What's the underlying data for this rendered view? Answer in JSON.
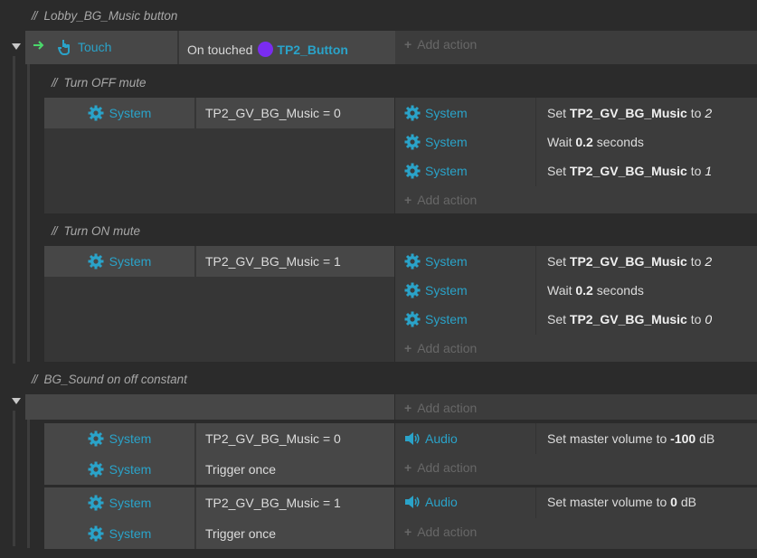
{
  "colors": {
    "accent": "#2aa3c9",
    "object_dot": "#7a2cf0",
    "trigger_arrow": "#4bd86b"
  },
  "groups": [
    {
      "comment": "Lobby_BG_Music button",
      "trigger": {
        "object": "Touch",
        "condition_prefix": "On touched",
        "condition_object": "TP2_Button",
        "add_action": "Add action"
      },
      "subevents": [
        {
          "comment": "Turn OFF mute",
          "conditions": [
            {
              "object": "System",
              "text": "TP2_GV_BG_Music = 0"
            }
          ],
          "actions": [
            {
              "object": "System",
              "icon": "gear-icon",
              "pre": "Set ",
              "bold": "TP2_GV_BG_Music",
              "mid": " to ",
              "italic": "2",
              "post": ""
            },
            {
              "object": "System",
              "icon": "gear-icon",
              "pre": "Wait ",
              "bold": "0.2",
              "mid": " seconds",
              "italic": "",
              "post": ""
            },
            {
              "object": "System",
              "icon": "gear-icon",
              "pre": "Set ",
              "bold": "TP2_GV_BG_Music",
              "mid": " to ",
              "italic": "1",
              "post": ""
            }
          ],
          "add_action": "Add action"
        },
        {
          "comment": "Turn ON mute",
          "conditions": [
            {
              "object": "System",
              "text": "TP2_GV_BG_Music = 1"
            }
          ],
          "actions": [
            {
              "object": "System",
              "icon": "gear-icon",
              "pre": "Set ",
              "bold": "TP2_GV_BG_Music",
              "mid": " to ",
              "italic": "2",
              "post": ""
            },
            {
              "object": "System",
              "icon": "gear-icon",
              "pre": "Wait ",
              "bold": "0.2",
              "mid": " seconds",
              "italic": "",
              "post": ""
            },
            {
              "object": "System",
              "icon": "gear-icon",
              "pre": "Set ",
              "bold": "TP2_GV_BG_Music",
              "mid": " to ",
              "italic": "0",
              "post": ""
            }
          ],
          "add_action": "Add action"
        }
      ]
    },
    {
      "comment": "BG_Sound on off constant",
      "add_action": "Add action",
      "subevents": [
        {
          "conditions": [
            {
              "object": "System",
              "text": "TP2_GV_BG_Music = 0"
            },
            {
              "object": "System",
              "text": "Trigger once"
            }
          ],
          "actions": [
            {
              "object": "Audio",
              "icon": "speaker-icon",
              "pre": "Set master volume to ",
              "bold": "-100",
              "mid": " dB",
              "italic": "",
              "post": ""
            }
          ],
          "add_action": "Add action"
        },
        {
          "conditions": [
            {
              "object": "System",
              "text": "TP2_GV_BG_Music = 1"
            },
            {
              "object": "System",
              "text": "Trigger once"
            }
          ],
          "actions": [
            {
              "object": "Audio",
              "icon": "speaker-icon",
              "pre": "Set master volume to ",
              "bold": "0",
              "mid": " dB",
              "italic": "",
              "post": ""
            }
          ],
          "add_action": "Add action"
        }
      ]
    }
  ]
}
